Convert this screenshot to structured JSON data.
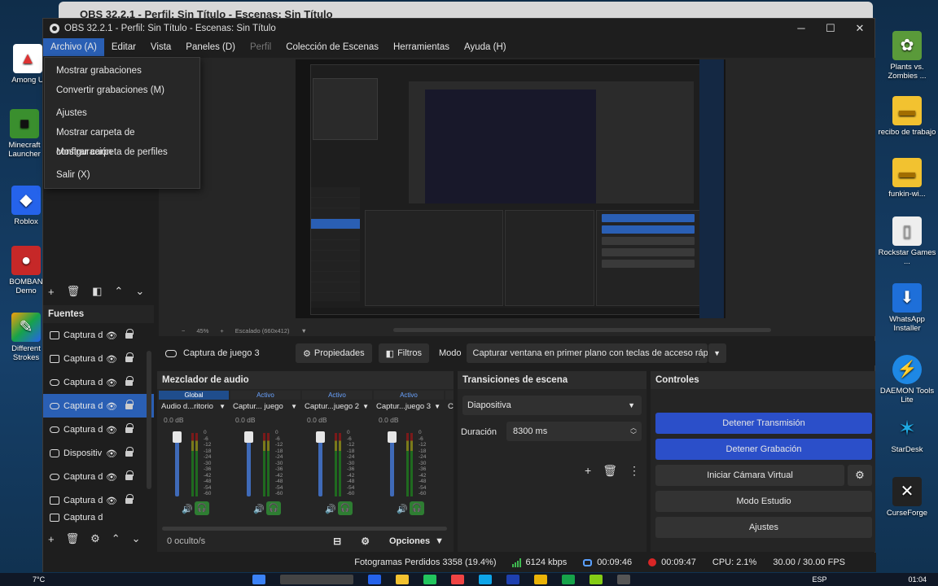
{
  "desktop": {
    "bg_window_title": "OBS 32.2.1 - Perfil: Sin Título - Escenas: Sin Título",
    "left_icons": [
      {
        "label": "Among U",
        "color": "#d33"
      },
      {
        "label": "Minecraft Launcher",
        "color": "#3a8f2e"
      },
      {
        "label": "Roblox",
        "color": "#2563eb"
      },
      {
        "label": "BOMBAN Demo",
        "color": "#c62828"
      },
      {
        "label": "Different Strokes",
        "color": "#f59e0b"
      }
    ],
    "right_icons": [
      {
        "label": "Plants vs. Zombies ...",
        "color": "#5a9a3a"
      },
      {
        "label": "recibo de trabajo",
        "color": "#f2c230"
      },
      {
        "label": "funkin-wi...",
        "color": "#f2c230"
      },
      {
        "label": "Rockstar Games ...",
        "color": "#eee"
      },
      {
        "label": "WhatsApp Installer",
        "color": "#1e6fd9"
      },
      {
        "label": "DAEMON Tools Lite",
        "color": "#1e88e5"
      },
      {
        "label": "StarDesk",
        "color": "#1ea7e1"
      },
      {
        "label": "CurseForge",
        "color": "#222"
      }
    ]
  },
  "window": {
    "title": "OBS 32.2.1 - Perfil: Sin Título - Escenas: Sin Título",
    "controls": [
      "─",
      "☐",
      "✕"
    ]
  },
  "menu": {
    "items": [
      {
        "label": "Archivo (A)",
        "state": "active"
      },
      {
        "label": "Editar",
        "state": "normal"
      },
      {
        "label": "Vista",
        "state": "normal"
      },
      {
        "label": "Paneles (D)",
        "state": "normal"
      },
      {
        "label": "Perfil",
        "state": "disabled"
      },
      {
        "label": "Colección de Escenas",
        "state": "normal"
      },
      {
        "label": "Herramientas",
        "state": "normal"
      },
      {
        "label": "Ayuda (H)",
        "state": "normal"
      }
    ],
    "archivo_dropdown": [
      "Mostrar grabaciones",
      "Convertir grabaciones (M)",
      "",
      "Ajustes",
      "Mostrar carpeta de configuración",
      "Mostrar carpeta de perfiles",
      "",
      "Salir (X)"
    ]
  },
  "preview": {
    "zoom": "45%",
    "scaling": "Escalado (660x412)"
  },
  "sources": {
    "title": "Fuentes",
    "items": [
      {
        "label": "Captura d",
        "icon": "window",
        "selected": false
      },
      {
        "label": "Captura d",
        "icon": "window",
        "selected": false
      },
      {
        "label": "Captura d",
        "icon": "gamepad",
        "selected": false
      },
      {
        "label": "Captura d",
        "icon": "gamepad",
        "selected": true
      },
      {
        "label": "Captura d",
        "icon": "gamepad",
        "selected": false
      },
      {
        "label": "Dispositiv",
        "icon": "camera",
        "selected": false
      },
      {
        "label": "Captura d",
        "icon": "gamepad",
        "selected": false
      },
      {
        "label": "Captura d",
        "icon": "window",
        "selected": false
      },
      {
        "label": "Captura d",
        "icon": "window",
        "selected": false
      }
    ]
  },
  "context_bar": {
    "source_name": "Captura de juego 3",
    "properties": "Propiedades",
    "filters": "Filtros",
    "mode_label": "Modo",
    "mode_value": "Capturar ventana en primer plano con teclas de acceso rápi"
  },
  "mixer": {
    "title": "Mezclador de audio",
    "channels": [
      {
        "status": "Global",
        "name": "Audio d...ritorio",
        "db": "0.0 dB"
      },
      {
        "status": "Activo",
        "name": "Captur... juego",
        "db": "0.0 dB"
      },
      {
        "status": "Activo",
        "name": "Captur...juego 2",
        "db": "0.0 dB"
      },
      {
        "status": "Activo",
        "name": "Captur...juego 3",
        "db": "0.0 dB"
      },
      {
        "status": "",
        "name": "Ca",
        "db": ""
      }
    ],
    "ticks": [
      "0",
      "-6",
      "-12",
      "-18",
      "-24",
      "-30",
      "-36",
      "-42",
      "-48",
      "-54",
      "-60"
    ],
    "hidden": "0 oculto/s",
    "options": "Opciones"
  },
  "transitions": {
    "title": "Transiciones de escena",
    "type": "Diapositiva",
    "duration_label": "Duración",
    "duration_value": "8300 ms"
  },
  "controls": {
    "title": "Controles",
    "stop_stream": "Detener Transmisión",
    "stop_record": "Detener Grabación",
    "virtual_cam": "Iniciar Cámara Virtual",
    "studio": "Modo Estudio",
    "settings": "Ajustes"
  },
  "status": {
    "dropped": "Fotogramas Perdidos 3358 (19.4%)",
    "bitrate": "6124 kbps",
    "stream_time": "00:09:46",
    "rec_time": "00:09:47",
    "cpu": "CPU: 2.1%",
    "fps": "30.00 / 30.00 FPS"
  },
  "taskbar": {
    "temp": "7°C",
    "lang": "ESP",
    "time": "01:04"
  }
}
